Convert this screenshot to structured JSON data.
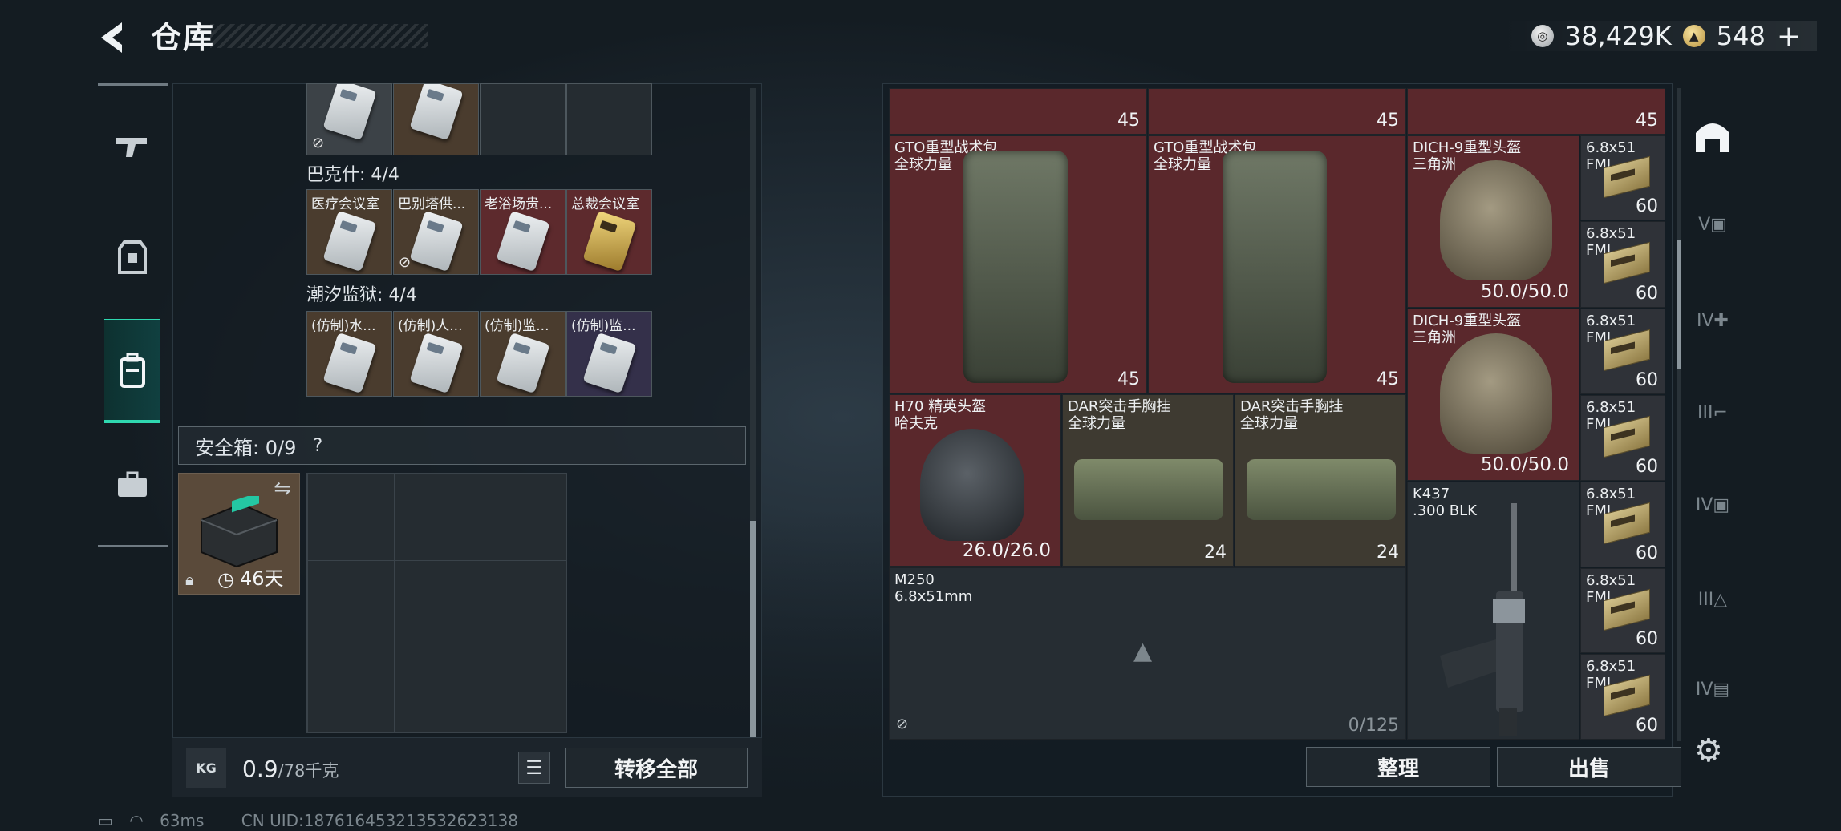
{
  "header": {
    "title": "仓库",
    "currency_silver": "38,429K",
    "currency_gold": "548",
    "plus": "+"
  },
  "left": {
    "group1_label": "巴克什: 4/4",
    "group1_items": [
      "医疗会议室",
      "巴别塔供...",
      "老浴场贵...",
      "总裁会议室"
    ],
    "group2_label": "潮汐监狱: 4/4",
    "group2_items": [
      "(仿制)水...",
      "(仿制)人...",
      "(仿制)监...",
      "(仿制)监..."
    ],
    "safebox_label": "安全箱: 0/9",
    "safebox_help": "?",
    "safebox_days": "46天",
    "weight_icon": "KG",
    "weight_value": "0.9",
    "weight_max": "/78千克",
    "transfer_all": "转移全部"
  },
  "right": {
    "top_counts": [
      "45",
      "45",
      "45"
    ],
    "items": {
      "gto1": {
        "label": "GTO重型战术包\n全球力量",
        "count": "45"
      },
      "gto2": {
        "label": "GTO重型战术包\n全球力量",
        "count": "45"
      },
      "dich1": {
        "label": "DICH-9重型头盔\n三角洲",
        "durability": "50.0/50.0"
      },
      "dich2": {
        "label": "DICH-9重型头盔\n三角洲",
        "durability": "50.0/50.0"
      },
      "h70": {
        "label": "H70 精英头盔\n哈夫克",
        "durability": "26.0/26.0"
      },
      "dar1": {
        "label": "DAR突击手胸挂\n全球力量",
        "count": "24"
      },
      "dar2": {
        "label": "DAR突击手胸挂\n全球力量",
        "count": "24"
      },
      "k437": {
        "label": "K437\n.300 BLK"
      },
      "m250": {
        "label": "M250\n6.8x51mm",
        "capacity": "0/125"
      }
    },
    "ammo": [
      {
        "label": "6.8x51\nFMJ",
        "count": "60"
      },
      {
        "label": "6.8x51\nFMJ",
        "count": "60"
      },
      {
        "label": "6.8x51\nFMJ",
        "count": "60"
      },
      {
        "label": "6.8x51\nFMJ",
        "count": "60"
      },
      {
        "label": "6.8x51\nFMJ",
        "count": "60"
      },
      {
        "label": "6.8x51\nFMJ",
        "count": "60"
      },
      {
        "label": "6.8x51\nFMJ",
        "count": "60"
      }
    ],
    "sort_button": "整理",
    "sell_button": "出售"
  },
  "status": {
    "ping": "63ms",
    "uid": "CN UID:187616453213532623138"
  },
  "colors": {
    "accent": "#2fd8b0",
    "red_cell": "#5a282c",
    "tan_cell": "#4a3c2e"
  }
}
